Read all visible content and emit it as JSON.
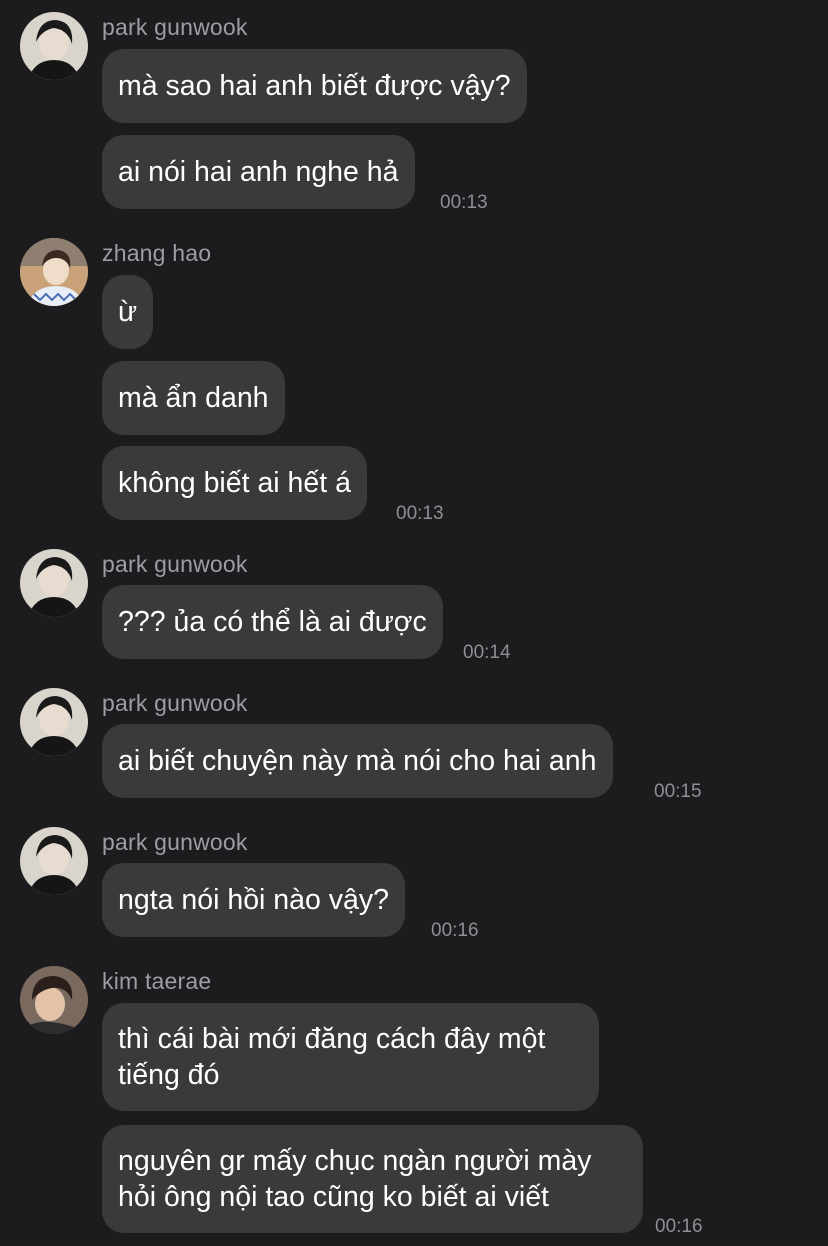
{
  "messages": [
    {
      "sender": "park gunwook",
      "bubbles": [
        "mà sao hai anh biết được vậy?",
        "ai nói hai anh nghe hả"
      ],
      "time": "00:13"
    },
    {
      "sender": "zhang hao",
      "bubbles": [
        "ừ",
        "mà ẩn danh",
        "không biết ai hết á"
      ],
      "time": "00:13"
    },
    {
      "sender": "park gunwook",
      "bubbles": [
        "??? ủa có thể là ai được"
      ],
      "time": "00:14"
    },
    {
      "sender": "park gunwook",
      "bubbles": [
        "ai biết chuyện này mà nói cho hai anh"
      ],
      "time": "00:15"
    },
    {
      "sender": "park gunwook",
      "bubbles": [
        "ngta nói hồi nào vậy?"
      ],
      "time": "00:16"
    },
    {
      "sender": "kim taerae",
      "bubbles": [
        [
          "thì cái bài mới đăng cách đây một",
          "tiếng đó"
        ],
        [
          "nguyên gr mấy chục ngàn người mày",
          "hỏi ông nội tao cũng ko biết ai viết"
        ]
      ],
      "time": "00:16"
    }
  ],
  "colors": {
    "background": "#1c1c1e",
    "bubble": "#3a3a3c",
    "sender": "#9d9da3",
    "timestamp": "#8e8e93",
    "text": "#ffffff"
  }
}
